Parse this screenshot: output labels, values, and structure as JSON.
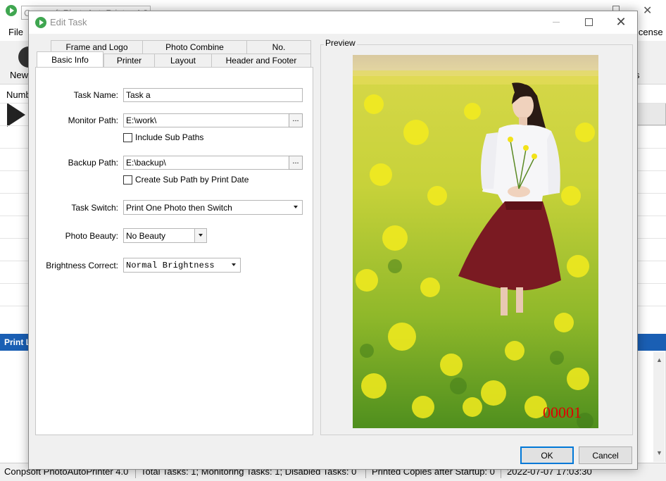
{
  "background": {
    "title": "Conpsoft PhotoAutoPrinter 4.0",
    "menu": {
      "file": "File",
      "license": "icense"
    },
    "toolbar": {
      "new_label": "New",
      "right_label": "s"
    },
    "list": {
      "header": "Numb"
    },
    "print_log": {
      "label": "Print L"
    },
    "status": {
      "app": "Conpsoft PhotoAutoPrinter 4.0",
      "tasks": "Total Tasks: 1; Monitoring Tasks: 1; Disabled Tasks: 0",
      "copies": "Printed Copies after Startup: 0",
      "datetime": "2022-07-07 17:03:30"
    }
  },
  "dialog": {
    "title": "Edit Task",
    "tabs_row1": [
      "Frame and Logo",
      "Photo Combine",
      "No."
    ],
    "tabs_row2": [
      "Basic Info",
      "Printer",
      "Layout",
      "Header and Footer"
    ],
    "active_tab": "Basic Info",
    "form": {
      "task_name": {
        "label": "Task Name:",
        "value": "Task a"
      },
      "monitor_path": {
        "label": "Monitor Path:",
        "value": "E:\\work\\",
        "browse": "..."
      },
      "include_sub_paths": {
        "label": "Include Sub Paths",
        "checked": false
      },
      "backup_path": {
        "label": "Backup Path:",
        "value": "E:\\backup\\",
        "browse": "..."
      },
      "create_sub_path": {
        "label": "Create Sub Path by Print Date",
        "checked": false
      },
      "task_switch": {
        "label": "Task Switch:",
        "value": "Print One Photo then Switch"
      },
      "photo_beauty": {
        "label": "Photo Beauty:",
        "value": "No Beauty"
      },
      "brightness_correct": {
        "label": "Brightness Correct:",
        "value": "Normal Brightness"
      }
    },
    "preview": {
      "label": "Preview",
      "photo_number": "00001",
      "photo_number_color": "#e00000"
    },
    "buttons": {
      "ok": "OK",
      "cancel": "Cancel"
    }
  }
}
